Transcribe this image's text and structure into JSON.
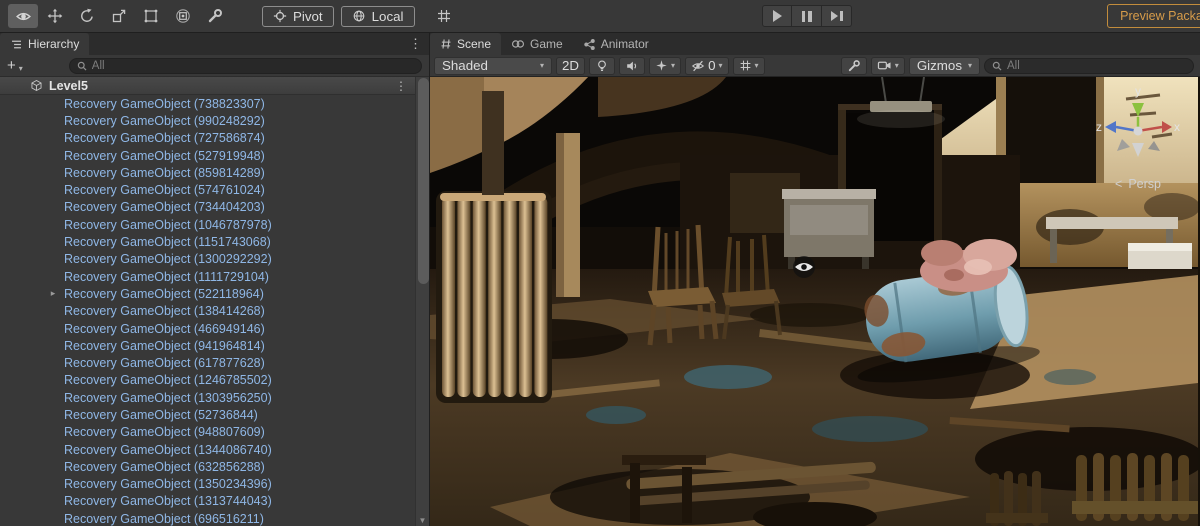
{
  "toolbar": {
    "pivot_label": "Pivot",
    "local_label": "Local",
    "preview_packages_label": "Preview Packages"
  },
  "hierarchy": {
    "tab_label": "Hierarchy",
    "search_placeholder": "All",
    "scene_name": "Level5",
    "items": [
      {
        "label": "Recovery GameObject (738823307)",
        "has_children": false
      },
      {
        "label": "Recovery GameObject (990248292)",
        "has_children": false
      },
      {
        "label": "Recovery GameObject (727586874)",
        "has_children": false
      },
      {
        "label": "Recovery GameObject (527919948)",
        "has_children": false
      },
      {
        "label": "Recovery GameObject (859814289)",
        "has_children": false
      },
      {
        "label": "Recovery GameObject (574761024)",
        "has_children": false
      },
      {
        "label": "Recovery GameObject (734404203)",
        "has_children": false
      },
      {
        "label": "Recovery GameObject (1046787978)",
        "has_children": false
      },
      {
        "label": "Recovery GameObject (1151743068)",
        "has_children": false
      },
      {
        "label": "Recovery GameObject (1300292292)",
        "has_children": false
      },
      {
        "label": "Recovery GameObject (1111729104)",
        "has_children": false
      },
      {
        "label": "Recovery GameObject (522118964)",
        "has_children": true
      },
      {
        "label": "Recovery GameObject (138414268)",
        "has_children": false
      },
      {
        "label": "Recovery GameObject (466949146)",
        "has_children": false
      },
      {
        "label": "Recovery GameObject (941964814)",
        "has_children": false
      },
      {
        "label": "Recovery GameObject (617877628)",
        "has_children": false
      },
      {
        "label": "Recovery GameObject (1246785502)",
        "has_children": false
      },
      {
        "label": "Recovery GameObject (1303956250)",
        "has_children": false
      },
      {
        "label": "Recovery GameObject (52736844)",
        "has_children": false
      },
      {
        "label": "Recovery GameObject (948807609)",
        "has_children": false
      },
      {
        "label": "Recovery GameObject (1344086740)",
        "has_children": false
      },
      {
        "label": "Recovery GameObject (632856288)",
        "has_children": false
      },
      {
        "label": "Recovery GameObject (1350234396)",
        "has_children": false
      },
      {
        "label": "Recovery GameObject (1313744043)",
        "has_children": false
      },
      {
        "label": "Recovery GameObject (696516211)",
        "has_children": false
      }
    ]
  },
  "scene_view": {
    "tabs": [
      {
        "label": "Scene"
      },
      {
        "label": "Game"
      },
      {
        "label": "Animator"
      }
    ],
    "toolbar": {
      "shading_mode": "Shaded",
      "mode_2d": "2D",
      "hidden_count": "0",
      "gizmos_label": "Gizmos",
      "search_placeholder": "All"
    },
    "gizmo": {
      "x": "x",
      "y": "y",
      "z": "z",
      "persp": "Persp",
      "persp_arrow": "<"
    }
  },
  "icons": {
    "plus": "+",
    "caret": "▾",
    "kebab": "⋮",
    "foldout": "▸",
    "scroll_down": "▼"
  },
  "colors": {
    "accent_orange": "#d79c4a",
    "prefab_item_text": "#8fb7e6",
    "panel_bg": "#383838",
    "strip_bg": "#2c2c2c"
  }
}
